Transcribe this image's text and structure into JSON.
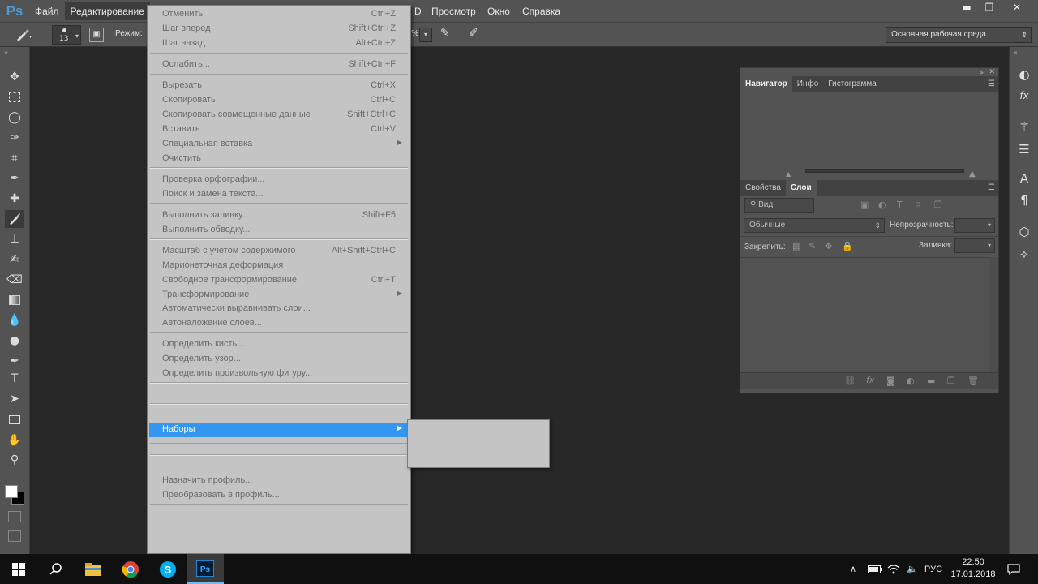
{
  "app": {
    "logo": "Ps"
  },
  "menubar": {
    "items": [
      "Файл",
      "Редактирование",
      "D",
      "Просмотр",
      "Окно",
      "Справка"
    ]
  },
  "window_controls": {
    "minimize": "▬",
    "restore": "❐",
    "close": "✕"
  },
  "options_bar": {
    "brush_size": "13",
    "mode_label": "Режим:",
    "opacity_fragment": "%",
    "workspace": "Основная рабочая среда"
  },
  "edit_menu": {
    "items": [
      {
        "label": "Отменить",
        "shortcut": "Ctrl+Z"
      },
      {
        "label": "Шаг вперед",
        "shortcut": "Shift+Ctrl+Z"
      },
      {
        "label": "Шаг назад",
        "shortcut": "Alt+Ctrl+Z"
      },
      {
        "label": "Ослабить...",
        "shortcut": "Shift+Ctrl+F"
      },
      {
        "label": "Вырезать",
        "shortcut": "Ctrl+X"
      },
      {
        "label": "Скопировать",
        "shortcut": "Ctrl+C"
      },
      {
        "label": "Скопировать совмещенные данные",
        "shortcut": "Shift+Ctrl+C"
      },
      {
        "label": "Вставить",
        "shortcut": "Ctrl+V"
      },
      {
        "label": "Специальная вставка",
        "shortcut": ""
      },
      {
        "label": "Очистить",
        "shortcut": ""
      },
      {
        "label": "Проверка орфографии...",
        "shortcut": ""
      },
      {
        "label": "Поиск и замена текста...",
        "shortcut": ""
      },
      {
        "label": "Выполнить заливку...",
        "shortcut": "Shift+F5"
      },
      {
        "label": "Выполнить обводку...",
        "shortcut": ""
      },
      {
        "label": "Масштаб с учетом содержимого",
        "shortcut": "Alt+Shift+Ctrl+C"
      },
      {
        "label": "Марионеточная деформация",
        "shortcut": ""
      },
      {
        "label": "Свободное трансформирование",
        "shortcut": "Ctrl+T"
      },
      {
        "label": "Трансформирование",
        "shortcut": ""
      },
      {
        "label": "Автоматически выравнивать слои...",
        "shortcut": ""
      },
      {
        "label": "Автоналожение слоев...",
        "shortcut": ""
      },
      {
        "label": "Определить кисть...",
        "shortcut": ""
      },
      {
        "label": "Определить узор...",
        "shortcut": ""
      },
      {
        "label": "Определить произвольную фигуру...",
        "shortcut": ""
      },
      {
        "label": "Наборы",
        "shortcut": ""
      },
      {
        "label": "Назначить профиль...",
        "shortcut": ""
      },
      {
        "label": "Преобразовать в профиль...",
        "shortcut": ""
      }
    ]
  },
  "panels": {
    "top_tabs": [
      "Навигатор",
      "Инфо",
      "Гистограмма"
    ],
    "bottom_tabs": [
      "Свойства",
      "Слои"
    ],
    "filter_kind": "Вид",
    "blend_mode": "Обычные",
    "opacity_label": "Непрозрачность:",
    "lock_label": "Закрепить:",
    "fill_label": "Заливка:"
  },
  "taskbar": {
    "lang": "РУС",
    "time": "22:50",
    "date": "17.01.2018"
  },
  "colors": {
    "accent": "#3396f0",
    "menu_bg": "#c4c4c4",
    "chrome": "#535353",
    "canvas": "#282828"
  }
}
